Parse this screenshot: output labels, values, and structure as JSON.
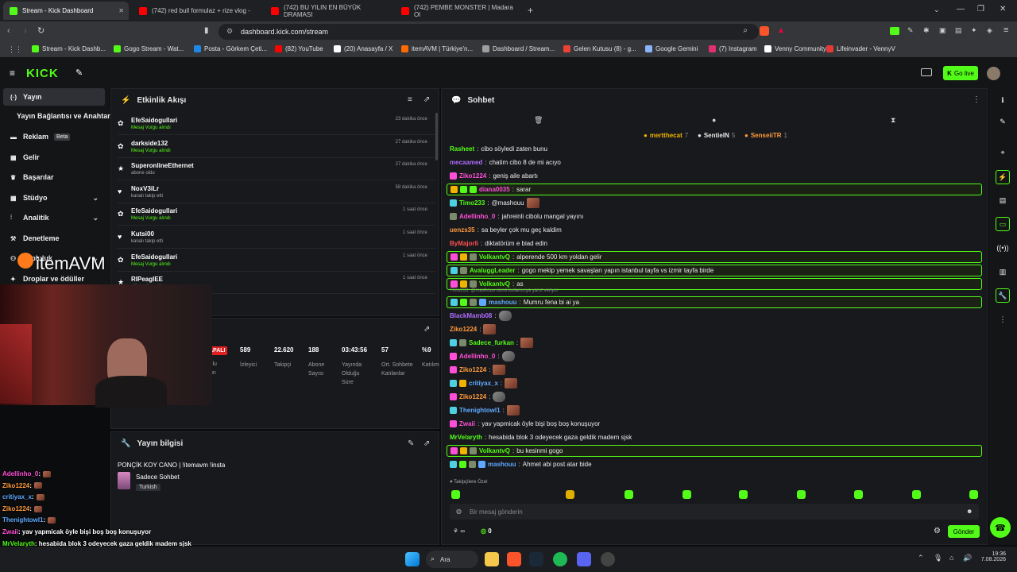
{
  "browser": {
    "tabs": [
      {
        "title": "Stream - Kick Dashboard",
        "active": true,
        "icon": "kick-icon"
      },
      {
        "title": "(742) red bull formulaz + rize vlog -",
        "icon": "youtube-icon"
      },
      {
        "title": "(742) BU YILIN EN BÜYÜK DRAMASI",
        "icon": "youtube-icon"
      },
      {
        "title": "(742) PEMBE MONSTER | Madara Ol",
        "icon": "youtube-icon"
      }
    ],
    "url": "dashboard.kick.com/stream",
    "bookmarks": [
      {
        "label": "Stream - Kick Dashb...",
        "color": "#53fc18"
      },
      {
        "label": "Gogo Stream - Wat...",
        "color": "#53fc18"
      },
      {
        "label": "Posta - Görkem Çeti...",
        "color": "#1e88e5"
      },
      {
        "label": "(82) YouTube",
        "color": "#ff0000"
      },
      {
        "label": "(20) Anasayfa / X",
        "color": "#ffffff"
      },
      {
        "label": "itemAVM | Türkiye'n...",
        "color": "#ff6a00"
      },
      {
        "label": "Dashboard / Stream...",
        "color": "#9e9e9e"
      },
      {
        "label": "Gelen Kutusu (8) - g...",
        "color": "#ea4335"
      },
      {
        "label": "Google Gemini",
        "color": "#8ab4f8"
      },
      {
        "label": "(7) Instagram",
        "color": "#e1306c"
      },
      {
        "label": "Venny Community",
        "color": "#ffffff"
      },
      {
        "label": "Lifeinvader - VennyV",
        "color": "#e53935"
      }
    ]
  },
  "kick": {
    "logo": "KICK",
    "go_live": "Go live",
    "accent": "#53fc18",
    "sidebar": [
      {
        "label": "Yayın",
        "icon": "stream-icon",
        "active": true
      },
      {
        "label": "Yayın Bağlantısı ve Anahtarı",
        "icon": ""
      },
      {
        "label": "Reklam",
        "icon": "ad-icon",
        "badge": "Beta"
      },
      {
        "label": "Gelir",
        "icon": "wallet-icon"
      },
      {
        "label": "Başarılar",
        "icon": "trophy-icon"
      },
      {
        "label": "Stüdyo",
        "icon": "grid-icon",
        "chevron": true
      },
      {
        "label": "Analitik",
        "icon": "chart-icon",
        "chevron": true
      },
      {
        "label": "Denetleme",
        "icon": "hammer-icon"
      },
      {
        "label": "Topluluk",
        "icon": "people-icon",
        "chevron": true
      },
      {
        "label": "Droplar ve ödüller",
        "icon": "gift-icon"
      }
    ]
  },
  "activity": {
    "title": "Etkinlik Akışı",
    "events": [
      {
        "name": "EfeSaidogullari",
        "sub": "Mesaj Vurgu alındı",
        "time": "23 dakika önce",
        "green": true
      },
      {
        "name": "darkside132",
        "sub": "Mesaj Vurgu alındı",
        "time": "27 dakika önce",
        "green": true
      },
      {
        "name": "SuperonlineEthernet",
        "sub": "abone oldu",
        "time": "27 dakika önce",
        "green": false
      },
      {
        "name": "NoxV3iLr",
        "sub": "kanalı takip etti",
        "time": "58 dakika önce",
        "green": false
      },
      {
        "name": "EfeSaidogullari",
        "sub": "Mesaj Vurgu alındı",
        "time": "1 saat önce",
        "green": true
      },
      {
        "name": "Kutsi00",
        "sub": "kanalı takip etti",
        "time": "1 saat önce",
        "green": false
      },
      {
        "name": "EfeSaidogullari",
        "sub": "Mesaj Vurgu alındı",
        "time": "1 saat önce",
        "green": true
      },
      {
        "name": "RIPeaglEE",
        "sub": "elik hediye etti.",
        "time": "1 saat önce",
        "green": false
      }
    ]
  },
  "stats": {
    "live_label": "APALI",
    "items": [
      {
        "value": "589",
        "label": "İzleyici"
      },
      {
        "value": "22.620",
        "label": "Takipçi"
      },
      {
        "value": "188",
        "label": "Abone Sayısı"
      },
      {
        "value": "03:43:56",
        "label": "Yayında Olduğu Süre"
      },
      {
        "value": "57",
        "label": "Ort. Sohbete Katılanlar"
      },
      {
        "value": "%9",
        "label": "Katılım"
      }
    ],
    "left_label": "klu",
    "left_label2": "un"
  },
  "stream_info": {
    "title": "Yayın bilgisi",
    "stream_title": "PONÇİK KOY CANO | !itemavm !insta",
    "category": "Sadece Sohbet",
    "tag": "Turkish"
  },
  "chat": {
    "title": "Sohbet",
    "top_gifters": [
      {
        "name": "mertthecat",
        "count": "7",
        "color": "#f0b400"
      },
      {
        "name": "SentieIN",
        "count": "5",
        "color": "#e8e8e8"
      },
      {
        "name": "SenseiiTR",
        "count": "1",
        "color": "#ff9a3c"
      }
    ],
    "messages": [
      {
        "user": "Rasheet",
        "color": "#53fc18",
        "text": "cibo söyledi zaten bunu"
      },
      {
        "user": "mecaamed",
        "color": "#b06cff",
        "text": "chatim cibo 8 de mi acıyo"
      },
      {
        "user": "Ziko1224",
        "color": "#ff4fd8",
        "text": "geniş aile abartı",
        "badges": [
          "mod"
        ]
      },
      {
        "user": "diana0035",
        "color": "#ff4fd8",
        "text": "sarar",
        "badges": [
          "gold",
          "sub",
          "gift"
        ],
        "highlight": true
      },
      {
        "user": "Timo233",
        "color": "#53fc18",
        "text": "@mashouu",
        "badges": [
          "vip"
        ],
        "emote": true
      },
      {
        "user": "Adellinho_0",
        "color": "#ff4fd8",
        "text": "jahreinli cibolu mangal yayını",
        "badges": [
          "og"
        ]
      },
      {
        "user": "uenzs35",
        "color": "#ff9a3c",
        "text": "sa beyler çok mu geç kaldim"
      },
      {
        "user": "ByMajorli",
        "color": "#ff5050",
        "text": "diktatörüm e biad edin"
      },
      {
        "user": "VolkantvQ",
        "color": "#53fc18",
        "text": "alperende 500 km yoldan gelir",
        "badges": [
          "mod",
          "gold",
          "og"
        ],
        "highlight": true
      },
      {
        "user": "AvaluggLeader",
        "color": "#53fc18",
        "text": "gogo mekip yemek savaşları yapın istanbul tayfa vs izmir tayfa birde",
        "badges": [
          "vip",
          "og"
        ],
        "highlight": true
      },
      {
        "user": "VolkantvQ",
        "color": "#53fc18",
        "text": "as",
        "badges": [
          "mod",
          "gold",
          "og"
        ],
        "highlight": true
      },
      {
        "user": "mashouu",
        "color": "#5fa8ff",
        "text": "Mumru fena bi ai ya",
        "badges": [
          "vip",
          "sub",
          "og",
          "sub2"
        ],
        "reply": "Timo233: @mashouu  isimli kullanıcıya yanıt veriyor",
        "highlight": true
      },
      {
        "user": "BlackMamb08",
        "color": "#b06cff",
        "text": "",
        "emote": true
      },
      {
        "user": "Ziko1224",
        "color": "#ff9a3c",
        "text": "",
        "emote": true
      },
      {
        "user": "Sadece_furkan",
        "color": "#53fc18",
        "text": "",
        "badges": [
          "vip",
          "og"
        ],
        "emote": true
      },
      {
        "user": "Adellinho_0",
        "color": "#ff4fd8",
        "text": "",
        "badges": [
          "mod"
        ],
        "emote": true
      },
      {
        "user": "Ziko1224",
        "color": "#ff9a3c",
        "text": "",
        "badges": [
          "mod"
        ],
        "emote": true
      },
      {
        "user": "critiyax_x",
        "color": "#5fa8ff",
        "text": "",
        "badges": [
          "vip",
          "gold"
        ],
        "emote": true
      },
      {
        "user": "Ziko1224",
        "color": "#ff9a3c",
        "text": "",
        "badges": [
          "mod"
        ],
        "emote": true
      },
      {
        "user": "Thenightowl1",
        "color": "#5fa8ff",
        "text": "",
        "badges": [
          "vip"
        ],
        "emote": true
      },
      {
        "user": "Zwaii",
        "color": "#ff4fd8",
        "text": "yav yapmicak öyle bişi boş boş konuşuyor",
        "badges": [
          "mod"
        ]
      },
      {
        "user": "MrVelaryth",
        "color": "#53fc18",
        "text": "hesabida blok 3 odeyecek gaza geldik madem sjsk"
      },
      {
        "user": "VolkantvQ",
        "color": "#53fc18",
        "text": "bu kesinmi gogo",
        "badges": [
          "mod",
          "gold",
          "og"
        ],
        "highlight": true
      },
      {
        "user": "mashouu",
        "color": "#5fa8ff",
        "text": "Ahmet abi post atar bide",
        "badges": [
          "vip",
          "sub",
          "og",
          "sub2"
        ]
      }
    ],
    "followers_only": "Takipçilere Özel",
    "placeholder": "Bir mesaj gönderin",
    "send": "Gönder",
    "infinity": "∞",
    "count": "0"
  },
  "overlay": {
    "sponsor": "itemAVM",
    "chat": [
      {
        "user": "Adellinho_0",
        "color": "#ff4fd8",
        "text": ":"
      },
      {
        "user": "Ziko1224",
        "color": "#ff9a3c",
        "text": ":"
      },
      {
        "user": "critiyax_x",
        "color": "#5fa8ff",
        "text": ":"
      },
      {
        "user": "Ziko1224",
        "color": "#ff9a3c",
        "text": ":"
      },
      {
        "user": "Thenightowl1",
        "color": "#5fa8ff",
        "text": ":"
      },
      {
        "user": "Zwaii",
        "color": "#ff4fd8",
        "text": ": yav yapmicak öyle bişi boş boş konuşuyor"
      },
      {
        "user": "MrVelaryth",
        "color": "#53fc18",
        "text": ": hesabida blok 3 odeyecek gaza geldik madem sjsk"
      },
      {
        "user": "VolkantvQ",
        "color": "#53fc18",
        "text": ": bu kesinmi gogo"
      },
      {
        "user": "mashouu",
        "color": "#5fa8ff",
        "text": ": Ahmet abi post atar bide"
      }
    ]
  },
  "taskbar": {
    "search": "Ara",
    "time": "19:36",
    "date": "7.08.2026"
  }
}
